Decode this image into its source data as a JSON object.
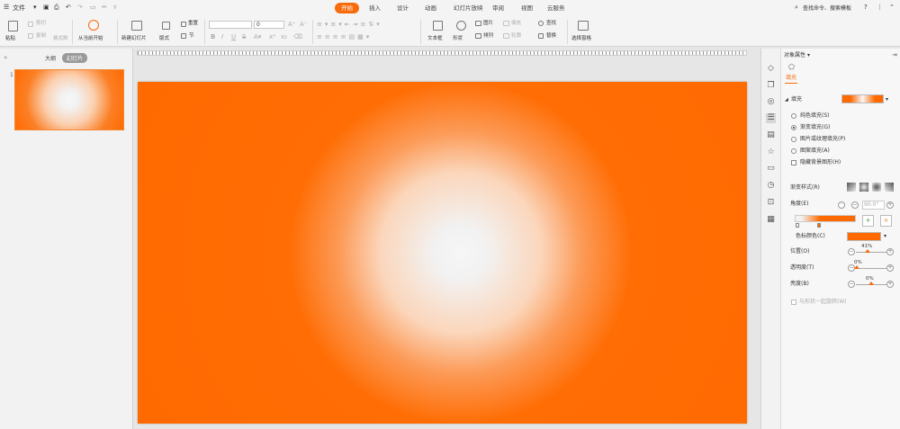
{
  "menubar": {
    "file_menu": "文件",
    "tabs": [
      "开始",
      "插入",
      "设计",
      "动画",
      "幻灯片放映",
      "审阅",
      "视图",
      "云服务"
    ],
    "active_tab": "开始",
    "search_placeholder": "查找命令、搜索模板",
    "help": "?",
    "menu_dots": "⋮"
  },
  "ribbon": {
    "paste": "粘贴",
    "cut": "剪切",
    "copy": "复制",
    "format_painter": "格式刷",
    "from_current": "从当前开始",
    "new_slide": "新建幻灯片",
    "layout": "版式",
    "reset": "重置",
    "section": "节",
    "font_size": "0",
    "textbox": "文本框",
    "shape": "形状",
    "picture": "图片",
    "fill": "填充",
    "find": "查找",
    "arrange": "排列",
    "outline": "轮廓",
    "replace": "替换",
    "select_pane": "选择窗格"
  },
  "leftpanel": {
    "tab_outline": "大纲",
    "tab_slides": "幻灯片",
    "slide_number": "1"
  },
  "rightpanel": {
    "title": "对象属性",
    "tab_fill": "填充",
    "section_fill": "填充",
    "options": [
      "纯色填充(S)",
      "渐变填充(G)",
      "图片或纹理填充(P)",
      "图案填充(A)"
    ],
    "selected_option": 1,
    "hide_bg": "隐藏背景图形(H)",
    "gradient_style": "渐变样式(R)",
    "angle": "角度(E)",
    "angle_value": "90.0°",
    "stop_color": "色标颜色(C)",
    "position": "位置(O)",
    "position_value": "41%",
    "transparency": "透明度(T)",
    "transparency_value": "0%",
    "brightness": "亮度(B)",
    "brightness_value": "0%",
    "rotate_with_shape": "与形状一起旋转(W)"
  },
  "colors": {
    "accent": "#f76b0c",
    "slide_fill": "#ff6a00",
    "center_fill": "#f2f2f2"
  },
  "icons": [
    "save-icon",
    "print-icon",
    "undo-icon",
    "redo-icon",
    "search-icon",
    "fill-icon",
    "shape-icon",
    "gear-icon"
  ]
}
